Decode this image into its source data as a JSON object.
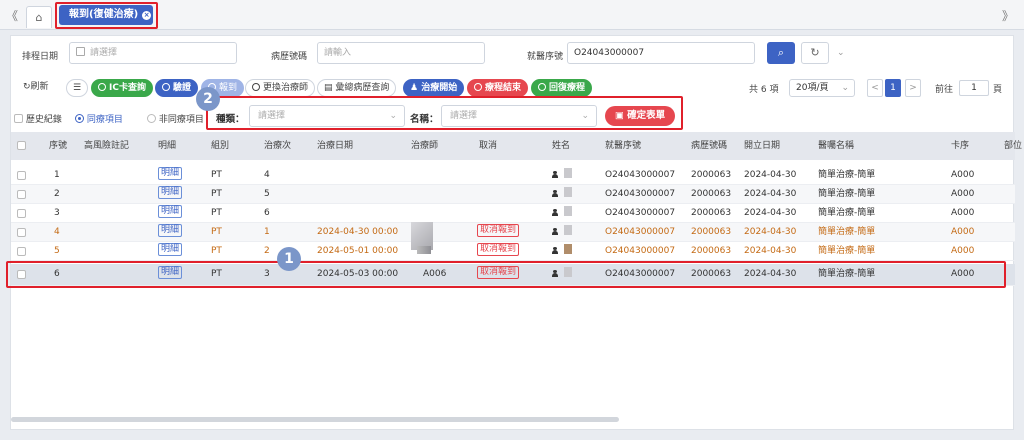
{
  "tabbar": {
    "prev_arrow": "《",
    "next_arrow": "》",
    "home_icon": "home-icon",
    "active_tab": "報到(復健治療)",
    "close_icon": "close-icon"
  },
  "filters": {
    "schedule_date_label": "排程日期",
    "schedule_date_placeholder": "請選擇",
    "chart_no_label": "病歷號碼",
    "chart_no_placeholder": "請輸入",
    "visit_no_label": "就醫序號",
    "visit_no_value": "O24043000007",
    "search_icon": "search-icon",
    "reset_icon": "refresh-icon",
    "more_icon": "chevron-down-icon"
  },
  "toolbar": {
    "refresh": "刷新",
    "columns_icon": "list-settings-icon",
    "ic_query": "IC卡查詢",
    "verify": "驗證",
    "checkin": "報到",
    "change_therapist": "更換治療師",
    "history_query": "彙總病歷查詢",
    "treatment_start": "治療開始",
    "course_end": "療程結束",
    "course_restore": "回復療程",
    "total": "共 6 項",
    "page_size": "20項/頁",
    "prev": "<",
    "current_page": "1",
    "next": ">",
    "goto_label": "前往",
    "goto_value": "1",
    "page_unit": "頁"
  },
  "options": {
    "history_record": "歷史紀錄",
    "same_course": "同療項目",
    "diff_course": "非同療項目",
    "category_label": "種類：",
    "category_placeholder": "請選擇",
    "name_label": "名稱：",
    "name_placeholder": "請選擇",
    "confirm_form": "確定表單"
  },
  "table": {
    "headers": [
      "序號",
      "高風險註記",
      "明細",
      "組別",
      "治療次",
      "治療日期",
      "治療師",
      "取消",
      "姓名",
      "就醫序號",
      "病歷號碼",
      "開立日期",
      "醫囑名稱",
      "卡序",
      "部位"
    ],
    "rows": [
      {
        "seq": "1",
        "detail": "明細",
        "group": "PT",
        "times": "4",
        "date": "",
        "therapist": "",
        "cancel": "",
        "visit": "O24043000007",
        "chart": "2000063",
        "order_date": "2024-04-30",
        "order": "簡單治療-簡單",
        "card": "A000"
      },
      {
        "seq": "2",
        "detail": "明細",
        "group": "PT",
        "times": "5",
        "date": "",
        "therapist": "",
        "cancel": "",
        "visit": "O24043000007",
        "chart": "2000063",
        "order_date": "2024-04-30",
        "order": "簡單治療-簡單",
        "card": "A000"
      },
      {
        "seq": "3",
        "detail": "明細",
        "group": "PT",
        "times": "6",
        "date": "",
        "therapist": "",
        "cancel": "",
        "visit": "O24043000007",
        "chart": "2000063",
        "order_date": "2024-04-30",
        "order": "簡單治療-簡單",
        "card": "A000"
      },
      {
        "seq": "4",
        "detail": "明細",
        "group": "PT",
        "times": "1",
        "date": "2024-04-30 00:00",
        "therapist": "",
        "cancel": "取消報到",
        "visit": "O24043000007",
        "chart": "2000063",
        "order_date": "2024-04-30",
        "order": "簡單治療-簡單",
        "card": "A000"
      },
      {
        "seq": "5",
        "detail": "明細",
        "group": "PT",
        "times": "2",
        "date": "2024-05-01 00:00",
        "therapist": "",
        "cancel": "取消報到",
        "visit": "O24043000007",
        "chart": "2000063",
        "order_date": "2024-04-30",
        "order": "簡單治療-簡單",
        "card": "A000"
      },
      {
        "seq": "6",
        "detail": "明細",
        "group": "PT",
        "times": "3",
        "date": "2024-05-03 00:00",
        "therapist": "A006",
        "cancel": "取消報到",
        "visit": "O24043000007",
        "chart": "2000063",
        "order_date": "2024-04-30",
        "order": "簡單治療-簡單",
        "card": "A000"
      }
    ]
  },
  "annotations": {
    "badge_1": "1",
    "badge_2": "2"
  },
  "colors": {
    "primary": "#3d63c4",
    "success": "#3aa84a",
    "danger": "#e6474f",
    "highlight": "#e0202b",
    "warning_text": "#c46a14"
  }
}
